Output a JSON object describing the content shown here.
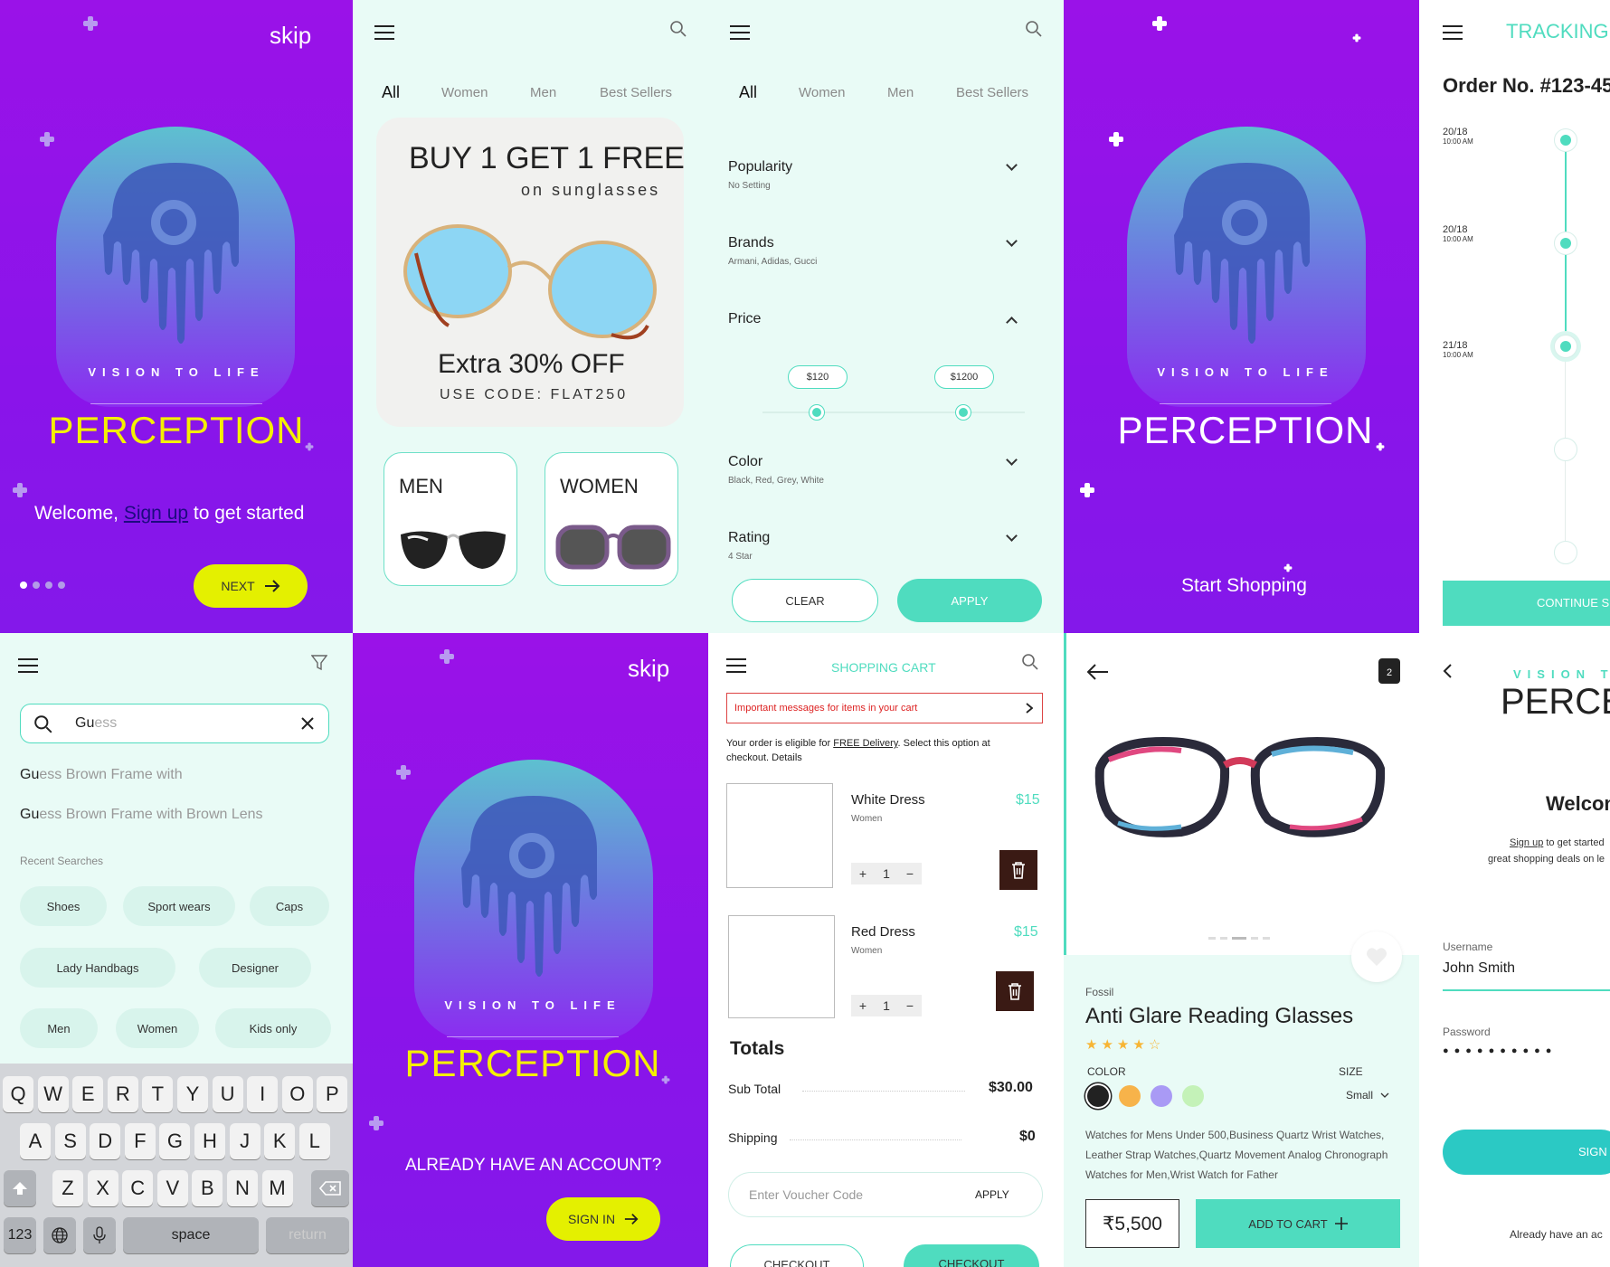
{
  "splash1": {
    "skip": "skip",
    "tagline": "VISION TO LIFE",
    "brand": "PERCEPTION",
    "welcome_pre": "Welcome,",
    "welcome_link": "Sign up",
    "welcome_post": "to get started",
    "next": "NEXT"
  },
  "shop": {
    "tabs": [
      "All",
      "Women",
      "Men",
      "Best Sellers"
    ],
    "promo_title": "BUY 1 GET 1 FREE",
    "promo_sub": "on sunglasses",
    "promo_offer": "Extra 30% OFF",
    "promo_code": "USE CODE: FLAT250",
    "cat_men": "MEN",
    "cat_women": "WOMEN"
  },
  "filter": {
    "tabs": [
      "All",
      "Women",
      "Men",
      "Best Sellers"
    ],
    "popularity": "Popularity",
    "popularity_val": "No Setting",
    "brands": "Brands",
    "brands_val": "Armani, Adidas, Gucci",
    "price": "Price",
    "price_min": "$120",
    "price_max": "$1200",
    "color": "Color",
    "color_val": "Black, Red, Grey, White",
    "rating": "Rating",
    "rating_val": "4 Star",
    "clear": "CLEAR",
    "apply": "APPLY"
  },
  "splash2": {
    "tagline": "VISION TO LIFE",
    "brand": "PERCEPTION",
    "cta": "Start Shopping"
  },
  "tracking": {
    "title": "TRACKING O",
    "order": "Order No. #123-45",
    "steps": [
      {
        "date": "20/18",
        "time": "10:00 AM"
      },
      {
        "date": "20/18",
        "time": "10:00 AM"
      },
      {
        "date": "21/18",
        "time": "10:00 AM"
      }
    ],
    "continue": "CONTINUE SH"
  },
  "search": {
    "value_typed": "Gu",
    "value_rest": "ess",
    "suggestions": [
      {
        "a": "Gu",
        "b": "ess Brown Frame with"
      },
      {
        "a": "Gu",
        "b": "ess Brown Frame with Brown Lens"
      }
    ],
    "recent_label": "Recent Searches",
    "chips": [
      "Shoes",
      "Sport wears",
      "Caps",
      "Lady Handbags",
      "Designer",
      "Men",
      "Women",
      "Kids only"
    ],
    "keys_row1": [
      "Q",
      "W",
      "E",
      "R",
      "T",
      "Y",
      "U",
      "I",
      "O",
      "P"
    ],
    "keys_row2": [
      "A",
      "S",
      "D",
      "F",
      "G",
      "H",
      "J",
      "K",
      "L"
    ],
    "keys_row3": [
      "Z",
      "X",
      "C",
      "V",
      "B",
      "N",
      "M"
    ],
    "key_123": "123",
    "key_space": "space",
    "key_return": "return"
  },
  "splash3": {
    "skip": "skip",
    "tagline": "VISION TO LIFE",
    "brand": "PERCEPTION",
    "question": "ALREADY HAVE AN ACCOUNT?",
    "signin": "SIGN IN"
  },
  "cart": {
    "title": "SHOPPING CART",
    "alert": "Important messages for items in your cart",
    "note_pre": "Your order is eligible for",
    "note_link": "FREE Delivery",
    "note_post": ". Select this option at checkout. Details",
    "items": [
      {
        "name": "White Dress",
        "cat": "Women",
        "price": "$15",
        "qty": "1"
      },
      {
        "name": "Red Dress",
        "cat": "Women",
        "price": "$15",
        "qty": "1"
      }
    ],
    "totals": "Totals",
    "subtotal_label": "Sub Total",
    "subtotal": "$30.00",
    "shipping_label": "Shipping",
    "shipping": "$0",
    "voucher_placeholder": "Enter Voucher Code",
    "voucher_apply": "APPLY",
    "checkout": "CHECKOUT"
  },
  "product": {
    "bag_count": "2",
    "brand": "Fossil",
    "name": "Anti Glare Reading Glasses",
    "rating": 4,
    "color_label": "COLOR",
    "size_label": "SIZE",
    "size": "Small",
    "colors": [
      "#222222",
      "#f7b34a",
      "#a99af5",
      "#c4f2b8"
    ],
    "desc": "Watches for Mens Under 500,Business Quartz Wrist Watches, Leather Strap Watches,Quartz Movement Analog Chronograph Watches for Men,Wrist Watch for Father",
    "price": "₹5,500",
    "add": "ADD TO CART"
  },
  "login": {
    "tagline": "VISION T",
    "brand": "PERCEP",
    "welcome": "Welcon",
    "signup_link": "Sign up",
    "signup_post": "to get started",
    "deals": "great shopping deals on le",
    "user_label": "Username",
    "user_value": "John Smith",
    "pass_label": "Password",
    "pass_mask": "●●●●●●●●●●",
    "signin": "SIGN I",
    "already": "Already have an ac"
  },
  "colors": {
    "accent": "#4fdcbf",
    "yellow": "#e4f000",
    "purple": "#8a14ea",
    "mint": "#e9fbf6"
  }
}
